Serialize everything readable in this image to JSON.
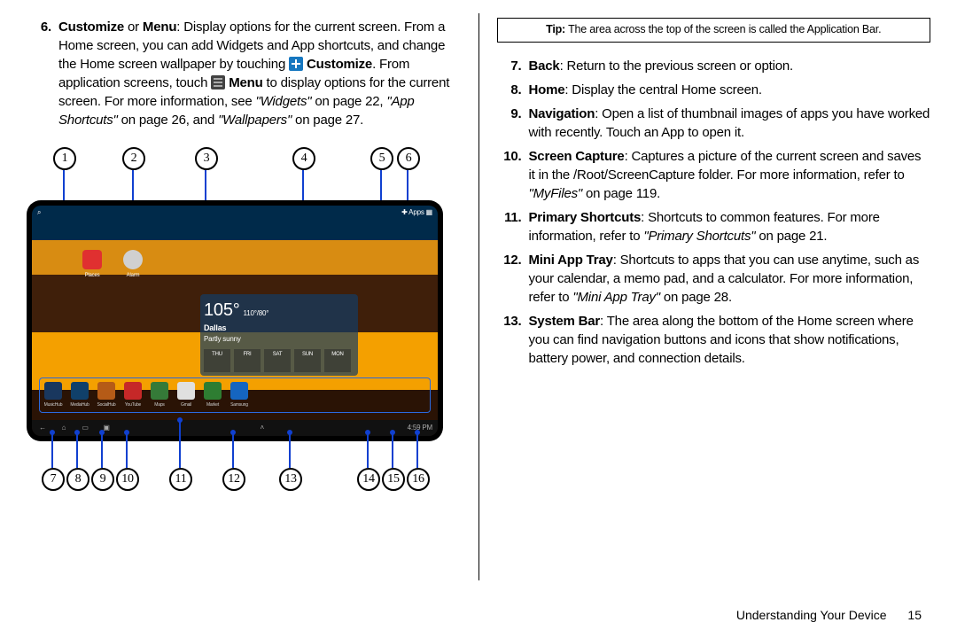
{
  "left": {
    "item6_num": "6.",
    "item6_a": "Customize",
    "item6_or": " or ",
    "item6_b": "Menu",
    "item6_text1": ": Display options for the current screen. From a Home screen, you can add Widgets and App shortcuts, and change the Home screen wallpaper by touching ",
    "item6_cust": " Customize",
    "item6_text2": ". From application screens, touch ",
    "item6_menu": " Menu",
    "item6_text3": " to display options for the current screen. For more information, see ",
    "widgets": "\"Widgets\"",
    "widgets_tail": " on page 22, ",
    "appshort": "\"App Shortcuts\"",
    "appshort_tail": " on page 26, and ",
    "wallp": "\"Wallpapers\"",
    "wallp_tail": " on page 27."
  },
  "callouts_top": [
    "1",
    "2",
    "3",
    "4",
    "5",
    "6"
  ],
  "callouts_bottom": [
    "7",
    "8",
    "9",
    "10",
    "11",
    "12",
    "13",
    "14",
    "15",
    "16"
  ],
  "appbar": {
    "left": "⌕",
    "right": "✚ Apps ▦"
  },
  "home_icons": [
    {
      "name": "Places",
      "color": "#e03030"
    },
    {
      "name": "Alarm",
      "color": "#d0d0d0"
    }
  ],
  "weather": {
    "temp": "105°",
    "range": "110°/80°",
    "city": "Dallas",
    "cond": "Partly sunny",
    "days": [
      "THU",
      "FRI",
      "SAT",
      "SUN",
      "MON"
    ]
  },
  "dock": [
    {
      "name": "MusicHub",
      "c": "#19375e"
    },
    {
      "name": "MediaHub",
      "c": "#10406a"
    },
    {
      "name": "SocialHub",
      "c": "#b55b17"
    },
    {
      "name": "YouTube",
      "c": "#c62828"
    },
    {
      "name": "Maps",
      "c": "#357a38"
    },
    {
      "name": "Gmail",
      "c": "#e0e0e0"
    },
    {
      "name": "Market",
      "c": "#2e7d32"
    },
    {
      "name": "Samsung",
      "c": "#1565c0"
    }
  ],
  "sysbar": {
    "time": "4:59 PM"
  },
  "right": {
    "tip_label": "Tip:",
    "tip_text": " The area across the top of the screen is called the Application Bar.",
    "items": [
      {
        "n": "7.",
        "b": "Back",
        "t": ": Return to the previous screen or option."
      },
      {
        "n": "8.",
        "b": "Home",
        "t": ": Display the central Home screen."
      },
      {
        "n": "9.",
        "b": "Navigation",
        "t": ": Open a list of thumbnail images of apps you have worked with recently. Touch an App to open it."
      }
    ],
    "item10_n": "10.",
    "item10_b": "Screen Capture",
    "item10_t1": ": Captures a picture of the current screen and saves it in the /Root/ScreenCapture folder. For more information, refer to ",
    "item10_i": "\"MyFiles\" ",
    "item10_t2": " on page 119.",
    "item11_n": "11.",
    "item11_b": "Primary Shortcuts",
    "item11_t1": ": Shortcuts to common features. For more information, refer to ",
    "item11_i": "\"Primary Shortcuts\" ",
    "item11_t2": " on page 21.",
    "item12_n": "12.",
    "item12_b": "Mini App Tray",
    "item12_t1": ": Shortcuts to apps that you can use anytime, such as your calendar, a memo pad, and a calculator. For more information, refer to ",
    "item12_i": "\"Mini App Tray\" ",
    "item12_t2": " on page 28.",
    "item13_n": "13.",
    "item13_b": "System Bar",
    "item13_t": ": The area along the bottom of the Home screen where you can find navigation buttons and icons that show notifications, battery power, and connection details."
  },
  "footer": {
    "chapter": "Understanding Your Device",
    "page": "15"
  }
}
